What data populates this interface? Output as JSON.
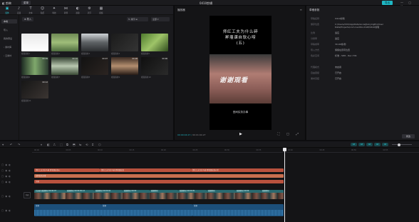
{
  "titlebar": {
    "logo": "◧ 剪映",
    "menu": "菜单",
    "doc_title": "0410剪辑",
    "export": "导出",
    "win_controls": "— ▢ ✕"
  },
  "toolbar": [
    {
      "label": "媒体",
      "icon": "▣",
      "name": "media-tool"
    },
    {
      "label": "音频",
      "icon": "♪",
      "name": "audio-tool"
    },
    {
      "label": "文本",
      "icon": "T",
      "name": "text-tool"
    },
    {
      "label": "贴纸",
      "icon": "☺",
      "name": "sticker-tool"
    },
    {
      "label": "特效",
      "icon": "✦",
      "name": "effects-tool"
    },
    {
      "label": "转场",
      "icon": "⋈",
      "name": "transition-tool"
    },
    {
      "label": "滤镜",
      "icon": "◐",
      "name": "filter-tool"
    },
    {
      "label": "调节",
      "icon": "⚙",
      "name": "adjust-tool"
    },
    {
      "label": "模板",
      "icon": "▦",
      "name": "template-tool"
    }
  ],
  "media_sidebar": [
    {
      "label": "本地",
      "active": true
    },
    {
      "label": "导入",
      "active": false
    },
    {
      "label": "我的预设",
      "active": false
    },
    {
      "label": "› 素材库",
      "active": false
    },
    {
      "label": "› 云素材",
      "active": false
    }
  ],
  "media_head": {
    "import": "⊕ 导入",
    "sort": "⇅ 排序 ⊞",
    "filter": "全部 ▾"
  },
  "thumbnails": [
    {
      "name": "视频素材1",
      "duration": "",
      "bg": "linear-gradient(180deg,#e9e9e9,#ffffff)"
    },
    {
      "name": "视频素材2",
      "duration": "",
      "bg": "linear-gradient(180deg,#6e8a54,#9fbd7a,#4f6e3f)"
    },
    {
      "name": "视频素材3",
      "duration": "",
      "bg": "linear-gradient(180deg,#cfd3d6,#5d6164,#2b2e30)"
    },
    {
      "name": "视频素材4",
      "duration": "",
      "bg": "linear-gradient(135deg,#1b1b1b,#343434)"
    },
    {
      "name": "视频素材5",
      "duration": "",
      "bg": "linear-gradient(135deg,#4e7a2d,#9ec468,#2f4b1d)"
    },
    {
      "name": "视频素材6",
      "duration": "00:09",
      "bg": "linear-gradient(90deg,#1d2a22,#7fa86c,#2b3a2f)"
    },
    {
      "name": "视频素材7",
      "duration": "00:10",
      "bg": "linear-gradient(180deg,#2e3b2c,#b9c8b0,#3a4a36)"
    },
    {
      "name": "视频素材8",
      "duration": "00:07",
      "bg": "linear-gradient(135deg,#121212,#2b2421)"
    },
    {
      "name": "视频素材9",
      "duration": "00:08",
      "bg": "linear-gradient(180deg,#3a2a22,#b38e6f,#261b15)"
    },
    {
      "name": "视频素材10",
      "duration": "00:06",
      "bg": "linear-gradient(135deg,#101010,#2a2a2a)"
    },
    {
      "name": "视频素材11",
      "duration": "00:12",
      "bg": "linear-gradient(135deg,#161616,#3b3532)"
    }
  ],
  "player": {
    "title": "播放器",
    "menu": "≡",
    "caption_lines": [
      "师红工夫为什么碎",
      "昇堰课自软心唠",
      "(五)"
    ],
    "sign": "谢谢观看",
    "caption2": "田间实务办事",
    "time_current": "00:00:04:27",
    "time_total": "00:01:04:27",
    "play_icon": "▶",
    "controls": "⛶ ▢ ⤢"
  },
  "props": {
    "title": "草稿参数",
    "rows": [
      {
        "key": "草稿名称",
        "value": "0410剪辑"
      },
      {
        "key": "保存位置",
        "value": "C:/Users/XXX/AppData/Local/JianyingPro/User Data/Projects/com.lveditor.draft/0410剪辑"
      },
      {
        "key": "比例",
        "value": "适应"
      },
      {
        "key": "分辨率",
        "value": "适应"
      },
      {
        "key": "草稿帧率",
        "value": "30.00帧/秒"
      },
      {
        "key": "导入方式",
        "value": "保留在原有位置"
      },
      {
        "key": "色彩空间",
        "value": "标准 - SDR - Rec.709"
      },
      {
        "key": "代理模式",
        "value": "未启用"
      },
      {
        "key": "自由层级",
        "value": "已开启"
      },
      {
        "key": "素材冻结",
        "value": "已开启"
      }
    ],
    "modify": "修改"
  },
  "timeline": {
    "tools_left": [
      "⌖",
      "↶",
      "↷",
      "⏸",
      "◧",
      "⎍",
      "⬚",
      "⧉",
      "⬒",
      "⇆",
      "⟲",
      "⌗",
      "⬡"
    ],
    "toggles": [
      "AB",
      "AB",
      "AB",
      "AB",
      "AB"
    ],
    "ruler_ticks": [
      "00:00",
      "00:05",
      "00:10",
      "00:15",
      "00:20",
      "00:25",
      "00:30",
      "00:35",
      "00:40",
      "00:45",
      "00:50",
      "00:55"
    ],
    "cover_label": "封面",
    "text_track_1": [
      {
        "label": "师红工夫为什么碎 昇堰课自软心",
        "start": 48,
        "width": 92
      },
      {
        "label": "师红工夫为什么碎 昇堰课自软",
        "start": 140,
        "width": 128
      },
      {
        "label": "师红工夫为什么碎 昇堰课自软心唠",
        "start": 268,
        "width": 130
      }
    ],
    "text_track_2": [
      {
        "label": "田间实务办事",
        "start": 48,
        "width": 350
      }
    ],
    "text_track_3": [
      {
        "label": "字幕",
        "start": 48,
        "width": 350
      }
    ],
    "video_clips": [
      {
        "label": "已选择 视频素材 00:00:07",
        "start": 48,
        "width": 44
      },
      {
        "label": "视频素材 00:00:05:13",
        "start": 92,
        "width": 40
      },
      {
        "label": "视频素材 00:00:04",
        "start": 132,
        "width": 40
      },
      {
        "label": "视频素材 00:00",
        "start": 172,
        "width": 38
      },
      {
        "label": "视频素材",
        "start": 210,
        "width": 40
      },
      {
        "label": "视频素材 00:00:05",
        "start": 250,
        "width": 40
      },
      {
        "label": "视频素材",
        "start": 290,
        "width": 40
      },
      {
        "label": "视频素材 00:00",
        "start": 330,
        "width": 36
      },
      {
        "label": "视频素材",
        "start": 366,
        "width": 32
      }
    ],
    "audio_clips": [
      {
        "label": "音频",
        "start": 48,
        "width": 94
      },
      {
        "label": "音频",
        "start": 142,
        "width": 128
      },
      {
        "label": "音频",
        "start": 270,
        "width": 128
      }
    ]
  }
}
